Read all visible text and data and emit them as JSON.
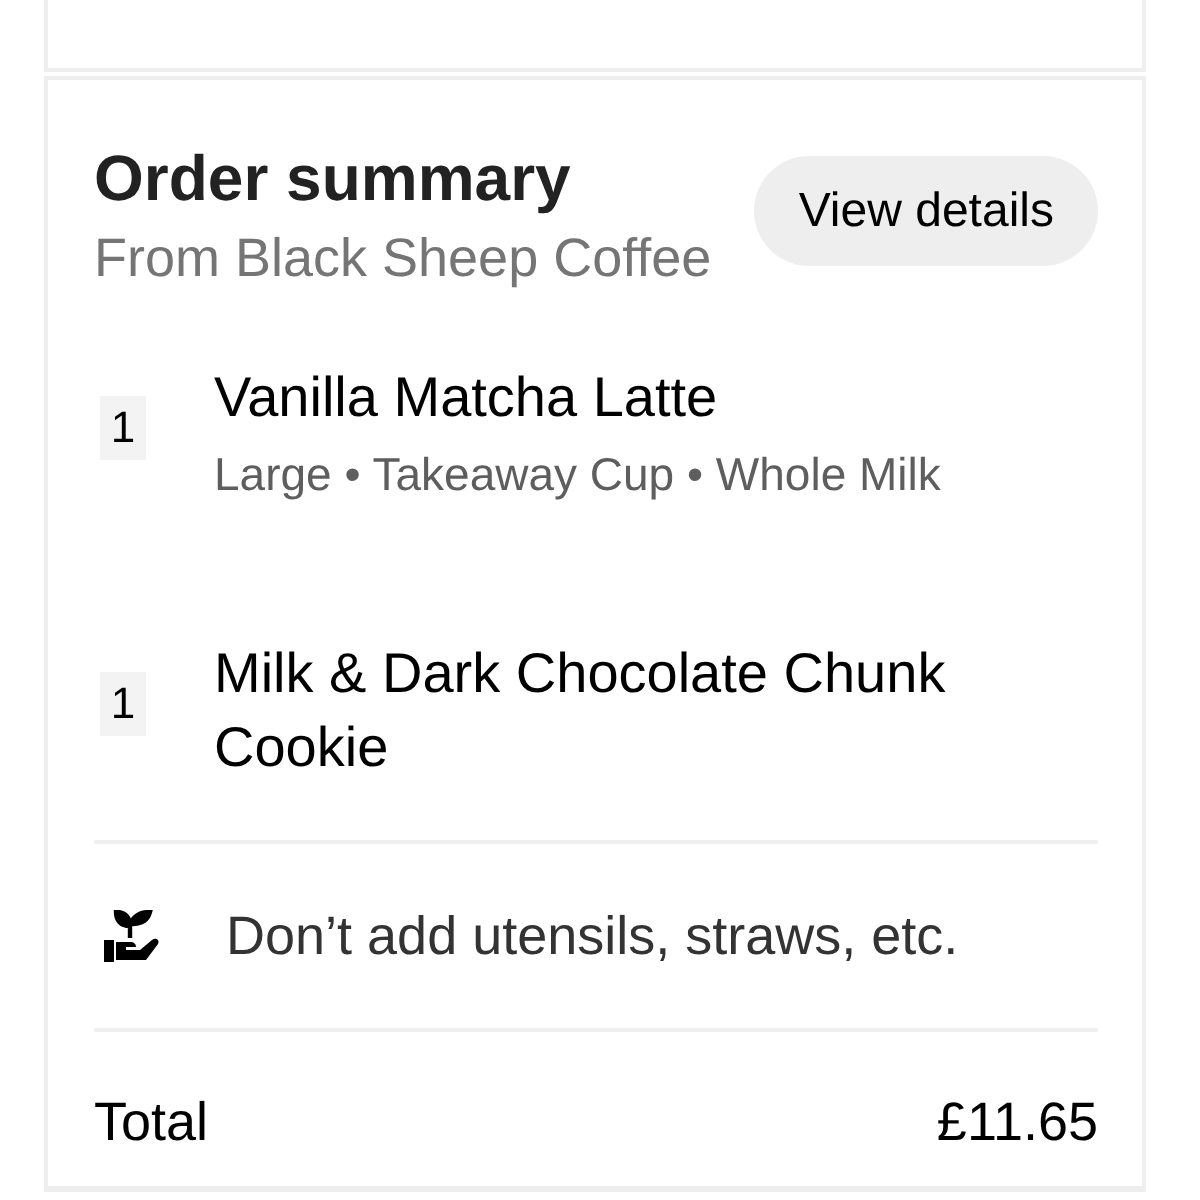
{
  "order_summary": {
    "title": "Order summary",
    "subtitle": "From Black Sheep Coffee",
    "button": "View details"
  },
  "items": [
    {
      "quantity": "1",
      "name": "Vanilla Matcha Latte",
      "options": "Large • Takeaway Cup • Whole Milk"
    },
    {
      "quantity": "1",
      "name": "Milk & Dark Chocolate Chunk Cookie"
    }
  ],
  "utensils": {
    "label": "Don’t add utensils, straws, etc."
  },
  "total": {
    "label": "Total",
    "amount": "£11.65"
  }
}
